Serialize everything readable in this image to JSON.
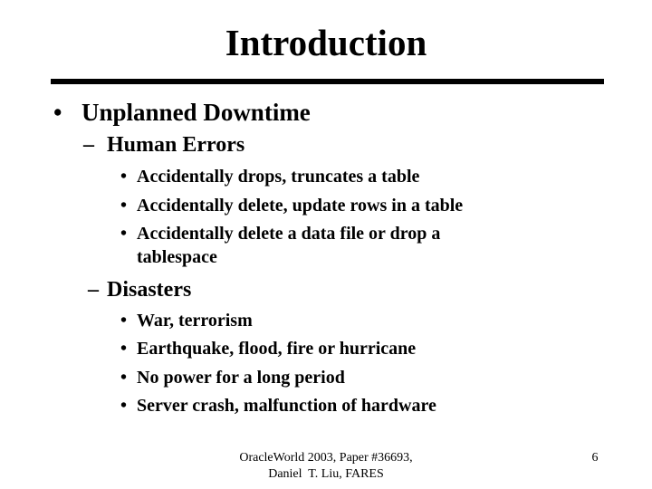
{
  "slide": {
    "title": "Introduction",
    "bullet_glyph": "•",
    "dash_glyph": "–",
    "sections": [
      {
        "label": "Unplanned Downtime",
        "subsections": [
          {
            "label": "Human Errors",
            "items": [
              "Accidentally drops, truncates a table",
              "Accidentally delete, update rows in a table",
              [
                "Accidentally delete a data file or drop a",
                "tablespace"
              ]
            ]
          },
          {
            "label": "Disasters",
            "items": [
              "War, terrorism",
              "Earthquake, flood, fire or hurricane",
              "No power for a long period",
              "Server crash, malfunction of hardware"
            ]
          }
        ]
      }
    ],
    "footer": {
      "line1": "OracleWorld 2003, Paper #36693,",
      "line2": "Daniel  T. Liu, FARES"
    },
    "page_number": "6"
  }
}
